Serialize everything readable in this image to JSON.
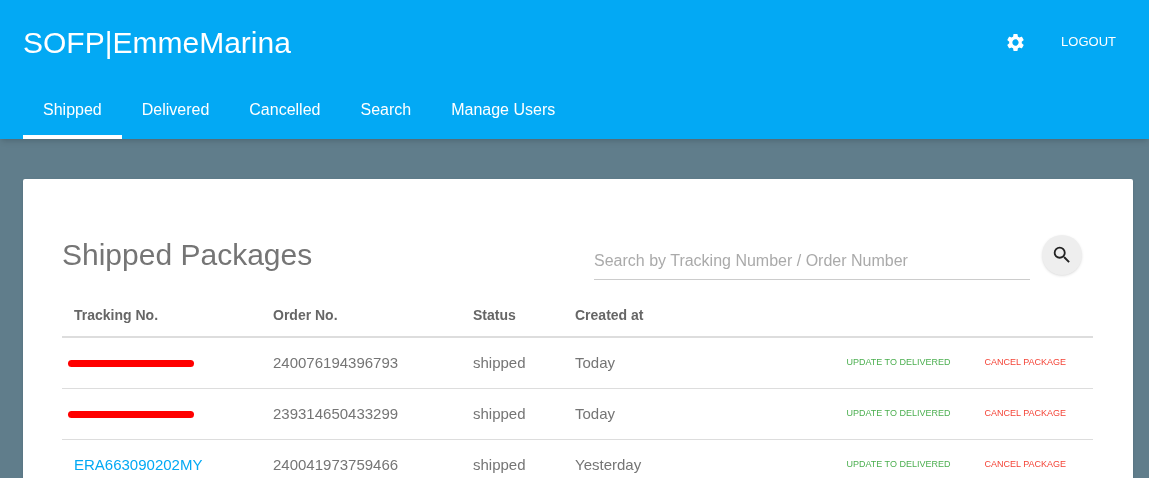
{
  "app_title": {
    "prefix": "SOFP",
    "separator": "|",
    "name": "EmmeMarina"
  },
  "header_actions": {
    "logout": "LOGOUT"
  },
  "tabs": [
    {
      "label": "Shipped",
      "selected": true
    },
    {
      "label": "Delivered",
      "selected": false
    },
    {
      "label": "Cancelled",
      "selected": false
    },
    {
      "label": "Search",
      "selected": false
    },
    {
      "label": "Manage Users",
      "selected": false
    }
  ],
  "card": {
    "title": "Shipped Packages",
    "search": {
      "placeholder": "Search by Tracking Number / Order Number"
    }
  },
  "table": {
    "columns": [
      "Tracking No.",
      "Order No.",
      "Status",
      "Created at"
    ],
    "rows": [
      {
        "tracking": "",
        "redacted": true,
        "order": "240076194396793",
        "status": "shipped",
        "created": "Today",
        "deliver_action": "UPDATE TO DELIVERED",
        "cancel_action": "CANCEL PACKAGE"
      },
      {
        "tracking": "",
        "redacted": true,
        "order": "239314650433299",
        "status": "shipped",
        "created": "Today",
        "deliver_action": "UPDATE TO DELIVERED",
        "cancel_action": "CANCEL PACKAGE"
      },
      {
        "tracking": "ERA663090202MY",
        "redacted": false,
        "order": "240041973759466",
        "status": "shipped",
        "created": "Yesterday",
        "deliver_action": "UPDATE TO DELIVERED",
        "cancel_action": "CANCEL PACKAGE"
      }
    ]
  }
}
